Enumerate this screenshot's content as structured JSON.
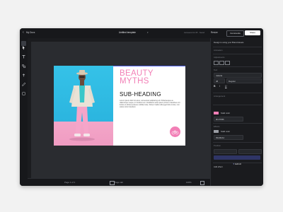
{
  "topbar": {
    "back_label": "My Docs",
    "doc_title": "Untitled template",
    "save_status": "Autosaved 12:45 · Saved",
    "resize_label": "Resize",
    "comments_label": "Comments",
    "share_label": "Share"
  },
  "tools": [
    {
      "name": "select",
      "label": "Select"
    },
    {
      "name": "text",
      "label": "Text"
    },
    {
      "name": "elements",
      "label": "Elements"
    },
    {
      "name": "uploads",
      "label": "Uploads"
    },
    {
      "name": "draw",
      "label": "Draw"
    },
    {
      "name": "brand",
      "label": "Brand"
    }
  ],
  "slide": {
    "title_line1": "BEAUTY",
    "title_line2": "MYTHS",
    "subheading": "SUB-HEADING",
    "body": "Lorem ipsum dolor sit amet, consectetur adipiscing elit. Pellentesque eu ullamcorper neque, in tincidunt est. Vestibulum ante ipsum primis in faucibus orci luctus et ultrices posuere cubilia curae. Donec mattis nulla eget felis cursus, non varius tortor interdum."
  },
  "bottombar": {
    "page_info": "Page 1 of 1",
    "page_label": "Page tab",
    "zoom": "100%"
  },
  "panel": {
    "hint": "Design is using your Brand Assets",
    "sections": [
      "Animation",
      "Adjustments",
      "Text",
      "Arrangement",
      "Effects",
      "Position"
    ],
    "font_label": "Jakarta",
    "font_weight": "Regular",
    "font_size": "48",
    "fill_label": "Solid color",
    "fill_color": "#F27FB6",
    "stroke_label": "Solid color",
    "stroke_color": "#9A9DA4",
    "layer_button": "Edit AI",
    "add_effect": "Add effect"
  },
  "colors": {
    "accent": "#5b6cff",
    "brand_pink": "#f27fb6",
    "dark_bg": "#1f2124"
  }
}
